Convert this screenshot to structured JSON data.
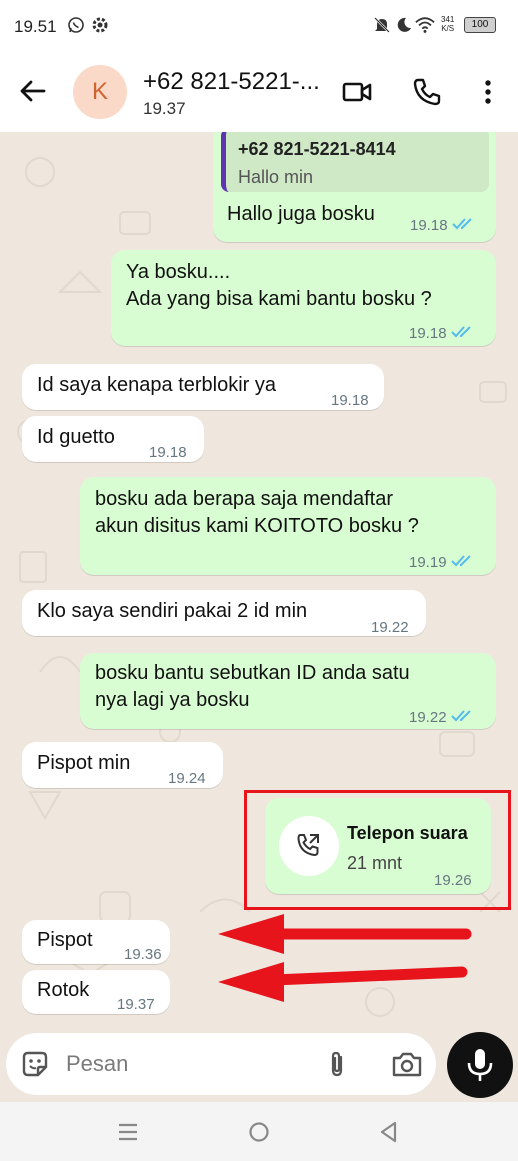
{
  "status_bar": {
    "time": "19.51",
    "net_speed_value": "341",
    "net_speed_unit": "K/S",
    "battery": "100"
  },
  "header": {
    "avatar_letter": "K",
    "contact_name": "+62 821-5221-...",
    "last_seen": "19.37"
  },
  "messages": [
    {
      "dir": "out",
      "reply_to_name": "+62 821-5221-8414",
      "reply_to_text": "Hallo min",
      "text": "Hallo juga bosku",
      "time": "19.18"
    },
    {
      "dir": "out",
      "text": "Ya bosku....\nAda yang bisa kami bantu bosku ?",
      "time": "19.18"
    },
    {
      "dir": "in",
      "text": "Id saya kenapa terblokir ya",
      "time": "19.18"
    },
    {
      "dir": "in",
      "text": "Id guetto",
      "time": "19.18"
    },
    {
      "dir": "out",
      "text": "bosku ada berapa saja mendaftar\nakun disitus kami KOITOTO bosku ?",
      "time": "19.19"
    },
    {
      "dir": "in",
      "text": "Klo saya sendiri pakai 2 id min",
      "time": "19.22"
    },
    {
      "dir": "out",
      "text": "bosku bantu sebutkan ID anda satu\nnya lagi ya bosku",
      "time": "19.22"
    },
    {
      "dir": "in",
      "text": "Pispot min",
      "time": "19.24"
    },
    {
      "dir": "out",
      "call_title": "Telepon suara",
      "call_duration": "21 mnt",
      "time": "19.26"
    },
    {
      "dir": "in",
      "text": "Pispot",
      "time": "19.36"
    },
    {
      "dir": "in",
      "text": "Rotok",
      "time": "19.37"
    }
  ],
  "input": {
    "placeholder": "Pesan"
  },
  "icons": {
    "back": "arrow-left-icon",
    "video": "video-call-icon",
    "voice": "phone-icon",
    "menu": "more-vertical-icon",
    "emoji": "sticker-icon",
    "attach": "paperclip-icon",
    "camera": "camera-icon",
    "mic": "microphone-icon",
    "call": "outgoing-call-icon"
  },
  "colors": {
    "outgoing_bubble": "#d9fdd3",
    "incoming_bubble": "#ffffff",
    "read_ticks": "#53bdeb",
    "annotation_red": "#e8141c",
    "avatar_bg": "#fbd9c8",
    "avatar_text": "#d0632f",
    "mic_button": "#111111"
  }
}
